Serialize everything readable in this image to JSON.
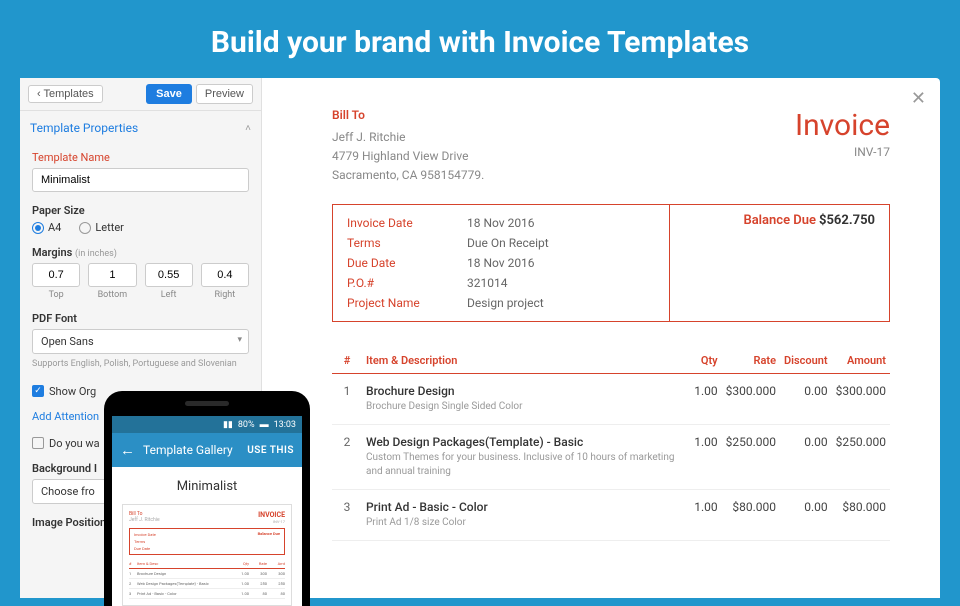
{
  "hero": {
    "title": "Build your brand with Invoice Templates"
  },
  "sidebar": {
    "back": "Templates",
    "save": "Save",
    "preview": "Preview",
    "section": "Template Properties",
    "name_label": "Template Name",
    "name_value": "Minimalist",
    "paper_label": "Paper Size",
    "paper_a4": "A4",
    "paper_letter": "Letter",
    "margins_label": "Margins",
    "margins_unit": "(in inches)",
    "m_top": "0.7",
    "m_bottom": "1",
    "m_left": "0.55",
    "m_right": "0.4",
    "m_top_l": "Top",
    "m_bottom_l": "Bottom",
    "m_left_l": "Left",
    "m_right_l": "Right",
    "pdffont_label": "PDF Font",
    "pdffont_value": "Open Sans",
    "font_hint": "Supports English, Polish, Portuguese and Slovenian",
    "show_org": "Show Org",
    "add_attention": "Add Attention",
    "do_you": "Do you wa",
    "bg_label": "Background I",
    "bg_value": "Choose fro",
    "img_pos_label": "Image Position"
  },
  "phone": {
    "status_pct": "80%",
    "status_time": "13:03",
    "bar_title": "Template Gallery",
    "bar_action": "USE THIS",
    "template_name": "Minimalist",
    "thumb_inv": "INVOICE",
    "thumb_id": "INV-17",
    "thumb_bal": "Balance Due"
  },
  "invoice": {
    "bill_to_label": "Bill To",
    "name": "Jeff J. Ritchie",
    "addr1": "4779 Highland View Drive",
    "addr2": "Sacramento, CA 958154779.",
    "title": "Invoice",
    "number": "INV-17",
    "meta": {
      "date_l": "Invoice Date",
      "date_v": "18 Nov 2016",
      "terms_l": "Terms",
      "terms_v": "Due On Receipt",
      "due_l": "Due Date",
      "due_v": "18 Nov 2016",
      "po_l": "P.O.#",
      "po_v": "321014",
      "proj_l": "Project Name",
      "proj_v": "Design project"
    },
    "bal_label": "Balance Due",
    "bal_value": "$562.750",
    "th": {
      "idx": "#",
      "item": "Item & Description",
      "qty": "Qty",
      "rate": "Rate",
      "disc": "Discount",
      "amt": "Amount"
    },
    "rows": [
      {
        "idx": "1",
        "name": "Brochure Design",
        "desc": "Brochure Design Single Sided Color",
        "qty": "1.00",
        "rate": "$300.000",
        "disc": "0.00",
        "amt": "$300.000"
      },
      {
        "idx": "2",
        "name": "Web Design Packages(Template) - Basic",
        "desc": "Custom Themes for your business. Inclusive of 10 hours of marketing and annual training",
        "qty": "1.00",
        "rate": "$250.000",
        "disc": "0.00",
        "amt": "$250.000"
      },
      {
        "idx": "3",
        "name": "Print Ad - Basic - Color",
        "desc": "Print Ad 1/8 size Color",
        "qty": "1.00",
        "rate": "$80.000",
        "disc": "0.00",
        "amt": "$80.000"
      }
    ]
  }
}
